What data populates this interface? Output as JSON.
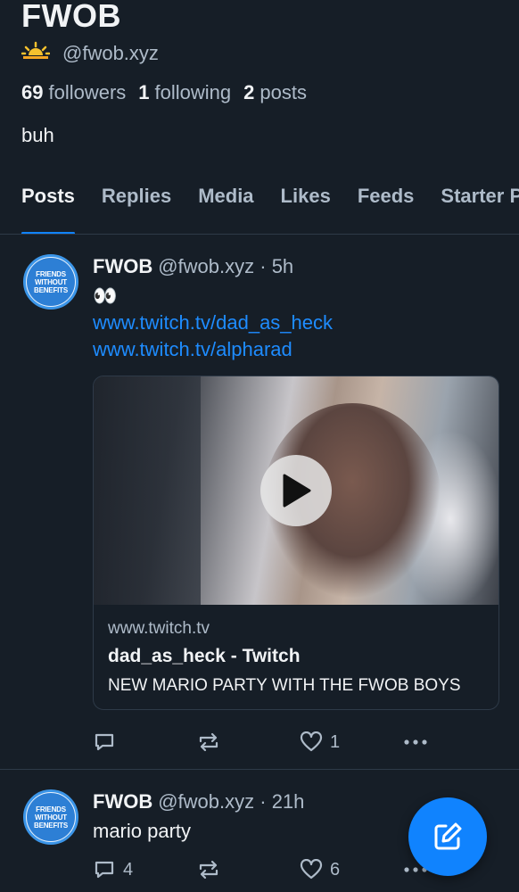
{
  "profile": {
    "display_name": "FWOB",
    "handle": "@fwob.xyz",
    "followers_count": "69",
    "followers_label": "followers",
    "following_count": "1",
    "following_label": "following",
    "posts_count": "2",
    "posts_label": "posts",
    "bio": "buh"
  },
  "tabs": [
    "Posts",
    "Replies",
    "Media",
    "Likes",
    "Feeds",
    "Starter Packs"
  ],
  "posts": [
    {
      "author_name": "FWOB",
      "author_handle": "@fwob.xyz",
      "time": "· 5h",
      "text": "👀",
      "links": [
        "www.twitch.tv/dad_as_heck",
        "www.twitch.tv/alpharad"
      ],
      "embed": {
        "domain": "www.twitch.tv",
        "title": "dad_as_heck - Twitch",
        "description": "NEW MARIO PARTY WITH THE FWOB BOYS"
      },
      "reply_count": "",
      "like_count": "1"
    },
    {
      "author_name": "FWOB",
      "author_handle": "@fwob.xyz",
      "time": "· 21h",
      "text": "mario party",
      "reply_count": "4",
      "like_count": "6"
    }
  ],
  "colors": {
    "accent": "#1083fe",
    "link": "#1e8cff",
    "background": "#161e27"
  },
  "icons": [
    "sunrise-emoji",
    "reply-icon",
    "repost-icon",
    "heart-icon",
    "more-icon",
    "play-icon",
    "compose-icon"
  ]
}
